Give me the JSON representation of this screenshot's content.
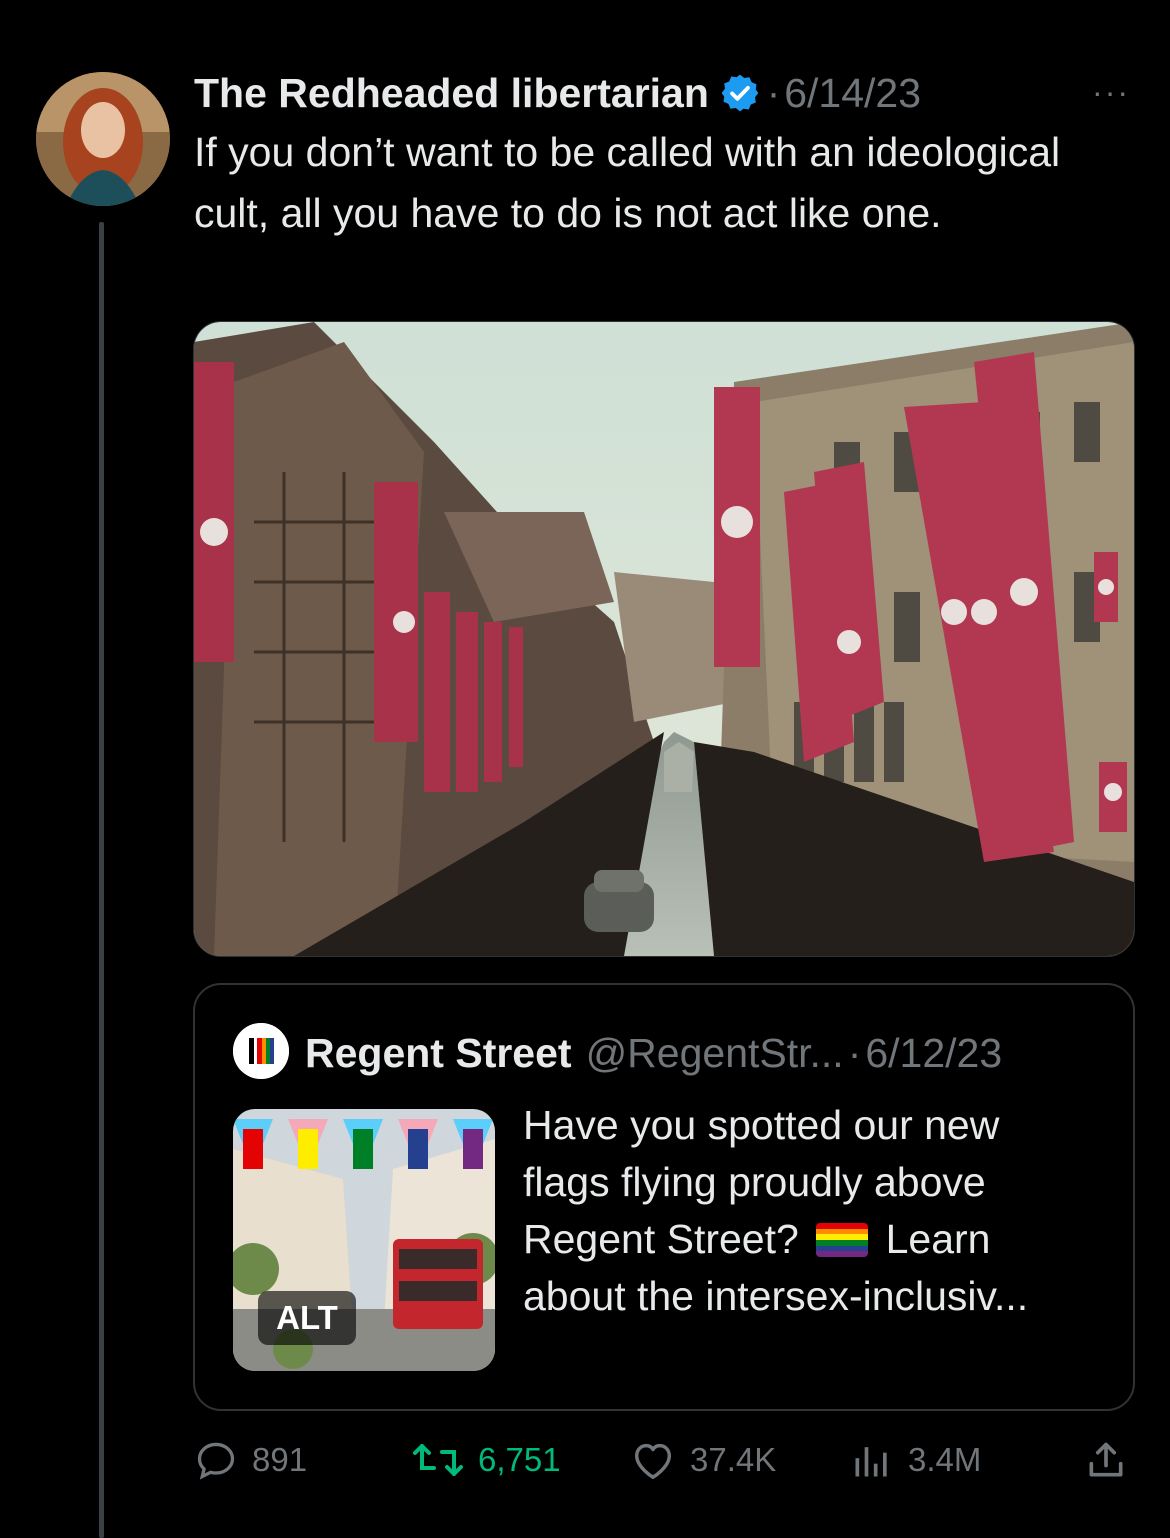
{
  "tweet": {
    "author_name": "The Redheaded libertarian",
    "verified": true,
    "separator": "·",
    "date": "6/14/23",
    "more_label": "···",
    "text": "If you don’t want to be called with an ideological cult, all you have to do is not act like one.",
    "media": {
      "type": "photo"
    }
  },
  "quote": {
    "author_name": "Regent Street",
    "handle": "@RegentStr...",
    "separator": "·",
    "date": "6/12/23",
    "alt_badge": "ALT",
    "text_before_emoji": "Have you spotted our new flags flying proudly above Regent Street?",
    "emoji": "rainbow-flag",
    "text_after_emoji": "Learn about the intersex-inclusiv..."
  },
  "actions": {
    "replies": "891",
    "retweets": "6,751",
    "likes": "37.4K",
    "views": "3.4M"
  },
  "colors": {
    "background": "#000000",
    "text": "#e7e9ea",
    "muted": "#71767b",
    "retweet_active": "#00ba7c",
    "verified": "#1d9bf0",
    "border": "#2f3336"
  }
}
